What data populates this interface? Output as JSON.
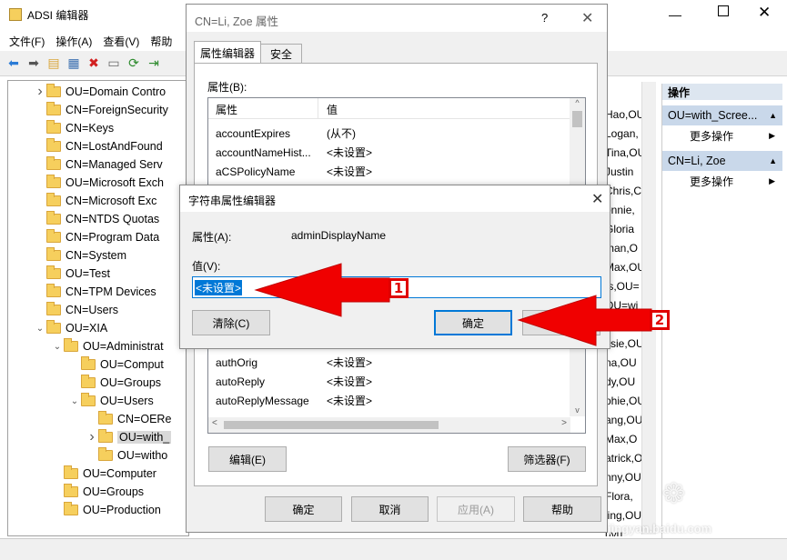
{
  "main_window": {
    "title": "ADSI 编辑器",
    "menu": [
      "文件(F)",
      "操作(A)",
      "查看(V)",
      "帮助"
    ],
    "tree_items": [
      {
        "label": "OU=Domain Contro",
        "indent": 1,
        "exp": "›"
      },
      {
        "label": "CN=ForeignSecurity",
        "indent": 1,
        "exp": ""
      },
      {
        "label": "CN=Keys",
        "indent": 1,
        "exp": ""
      },
      {
        "label": "CN=LostAndFound",
        "indent": 1,
        "exp": ""
      },
      {
        "label": "CN=Managed Serv",
        "indent": 1,
        "exp": ""
      },
      {
        "label": "OU=Microsoft Exch",
        "indent": 1,
        "exp": ""
      },
      {
        "label": "CN=Microsoft Exc",
        "indent": 1,
        "exp": ""
      },
      {
        "label": "CN=NTDS Quotas",
        "indent": 1,
        "exp": ""
      },
      {
        "label": "CN=Program Data",
        "indent": 1,
        "exp": ""
      },
      {
        "label": "CN=System",
        "indent": 1,
        "exp": ""
      },
      {
        "label": "OU=Test",
        "indent": 1,
        "exp": ""
      },
      {
        "label": "CN=TPM Devices",
        "indent": 1,
        "exp": ""
      },
      {
        "label": "CN=Users",
        "indent": 1,
        "exp": ""
      },
      {
        "label": "OU=XIA",
        "indent": 1,
        "exp": "⌄"
      },
      {
        "label": "OU=Administrat",
        "indent": 2,
        "exp": "⌄"
      },
      {
        "label": "OU=Comput",
        "indent": 3,
        "exp": ""
      },
      {
        "label": "OU=Groups",
        "indent": 3,
        "exp": ""
      },
      {
        "label": "OU=Users",
        "indent": 3,
        "exp": "⌄"
      },
      {
        "label": "CN=OERe",
        "indent": 4,
        "exp": ""
      },
      {
        "label": "OU=with_",
        "indent": 4,
        "exp": "›",
        "selected": true
      },
      {
        "label": "OU=witho",
        "indent": 4,
        "exp": ""
      },
      {
        "label": "OU=Computer",
        "indent": 2,
        "exp": ""
      },
      {
        "label": "OU=Groups",
        "indent": 2,
        "exp": ""
      },
      {
        "label": "OU=Production",
        "indent": 2,
        "exp": ""
      }
    ],
    "right_list": [
      "Hao,OU",
      "Logan,",
      "Tina,OU",
      "Justin",
      "Chris,C",
      "onnie,",
      "Gloria",
      "man,O",
      "Max,OU",
      "ts,OU=",
      "OU=wi",
      "",
      "ssie,OU",
      "na,OU",
      "dy,OU",
      "phie,OU",
      "ang,OU",
      "Max,O",
      "atrick,O",
      "nny,OU",
      "Flora,",
      "jing,OU",
      "uyu,"
    ],
    "actions": {
      "header": "操作",
      "sections": [
        {
          "title": "OU=with_Scree...",
          "item": "更多操作"
        },
        {
          "title": "CN=Li, Zoe",
          "item": "更多操作"
        }
      ]
    }
  },
  "props_dialog": {
    "title": "CN=Li, Zoe 属性",
    "help": "?",
    "tabs": [
      "属性编辑器",
      "安全"
    ],
    "attr_label": "属性(B):",
    "col_attr": "属性",
    "col_val": "值",
    "rows_top": [
      {
        "attr": "accountExpires",
        "val": "(从不)"
      },
      {
        "attr": "accountNameHist...",
        "val": "<未设置>"
      },
      {
        "attr": "aCSPolicyName",
        "val": "<未设置>"
      }
    ],
    "rows_bottom": [
      {
        "attr": "authOrig",
        "val": "<未设置>"
      },
      {
        "attr": "autoReply",
        "val": "<未设置>"
      },
      {
        "attr": "autoReplyMessage",
        "val": "<未设置>"
      }
    ],
    "edit_btn": "编辑(E)",
    "filter_btn": "筛选器(F)",
    "ok": "确定",
    "cancel": "取消",
    "apply": "应用(A)",
    "helpbtn": "帮助"
  },
  "string_dialog": {
    "title": "字符串属性编辑器",
    "attr_label": "属性(A):",
    "attr_value": "adminDisplayName",
    "value_label": "值(V):",
    "value": "<未设置>",
    "clear_btn": "清除(C)",
    "ok_btn": "确定"
  },
  "annotations": {
    "one": "1",
    "two": "2"
  },
  "watermark": "jingyan.baidu.com",
  "colors": {
    "arrow": "#e00000",
    "selection": "#0078d7"
  }
}
